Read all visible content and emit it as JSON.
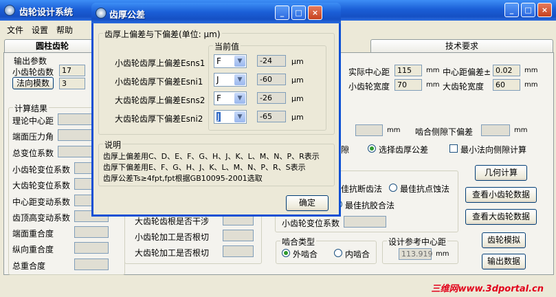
{
  "app": {
    "title": "齿轮设计系统",
    "menu": [
      "文件",
      "设置",
      "帮助"
    ],
    "tabs": [
      "圆柱齿轮",
      "技术要求"
    ]
  },
  "output_params": {
    "title": "输出参数",
    "small_teeth_label": "小齿轮齿数",
    "small_teeth_value": "17",
    "normal_module_button": "法向模数",
    "normal_module_value": "3"
  },
  "right_params": {
    "actual_center_label": "实际中心距",
    "actual_center_value": "115",
    "actual_center_unit": "mm",
    "center_dev_label": "中心距偏差±",
    "center_dev_value": "0.02",
    "center_dev_unit": "mm",
    "small_width_label": "小齿轮宽度",
    "small_width_value": "70",
    "small_width_unit": "mm",
    "large_width_label": "大齿轮宽度",
    "large_width_value": "60",
    "large_width_unit": "mm"
  },
  "calc_results": {
    "title": "计算结果",
    "labels": [
      "理论中心距",
      "端面压力角",
      "总变位系数",
      "小齿轮变位系数",
      "大齿轮变位系数",
      "中心距变动系数",
      "齿顶高变动系数",
      "端面重合度",
      "纵向重合度",
      "总重合度"
    ]
  },
  "backlash": {
    "mm1": "mm",
    "lower_dev_label": "啮合侧隙下偏差",
    "mm2": "mm",
    "opt_gap_tail": "隙",
    "opt_thickness_tol": "选择齿厚公差",
    "opt_min_normal": "最小法向侧隙计算"
  },
  "mid_area": {
    "row1": "大齿轮齿根是否干涉",
    "row2": "小齿轮加工是否根切",
    "row3": "大齿轮加工是否根切"
  },
  "method": {
    "opt1_tail": "佳抗断齿法",
    "opt2": "最佳抗点蚀法",
    "opt3": "最佳抗胶合法",
    "small_shift_label": "小齿轮变位系数"
  },
  "mesh": {
    "title": "啮合类型",
    "external": "外啮合",
    "internal": "内啮合"
  },
  "ref_center": {
    "title": "设计参考中心距",
    "value": "113.919",
    "unit": "mm"
  },
  "right_buttons": [
    "几何计算",
    "查看小齿轮数据",
    "查看大齿轮数据",
    "齿轮模拟",
    "输出数据"
  ],
  "dialog": {
    "title": "齿厚公差",
    "group_title": "齿厚上偏差与下偏差(单位: μm)",
    "current_title": "当前值",
    "unit": "μm",
    "rows": [
      {
        "label": "小齿轮齿厚上偏差Esns1",
        "select": "F",
        "value": "-24"
      },
      {
        "label": "小齿轮齿厚下偏差Esni1",
        "select": "J",
        "value": "-60"
      },
      {
        "label": "大齿轮齿厚上偏差Esns2",
        "select": "F",
        "value": "-26"
      },
      {
        "label": "大齿轮齿厚下偏差Esni2",
        "select": "J",
        "value": "-65"
      }
    ],
    "note_title": "说明",
    "notes": [
      "齿厚上偏差用C、D、E、F、G、H、J、K、L、M、N、P、R表示",
      "齿厚下偏差用E、F、G、H、J、K、L、M、N、P、R、S表示",
      "齿厚公差Ts≥4fpt,fpt根据GB10095-2001选取"
    ],
    "ok": "确定"
  },
  "watermark": "三维网www.3dportal.cn"
}
